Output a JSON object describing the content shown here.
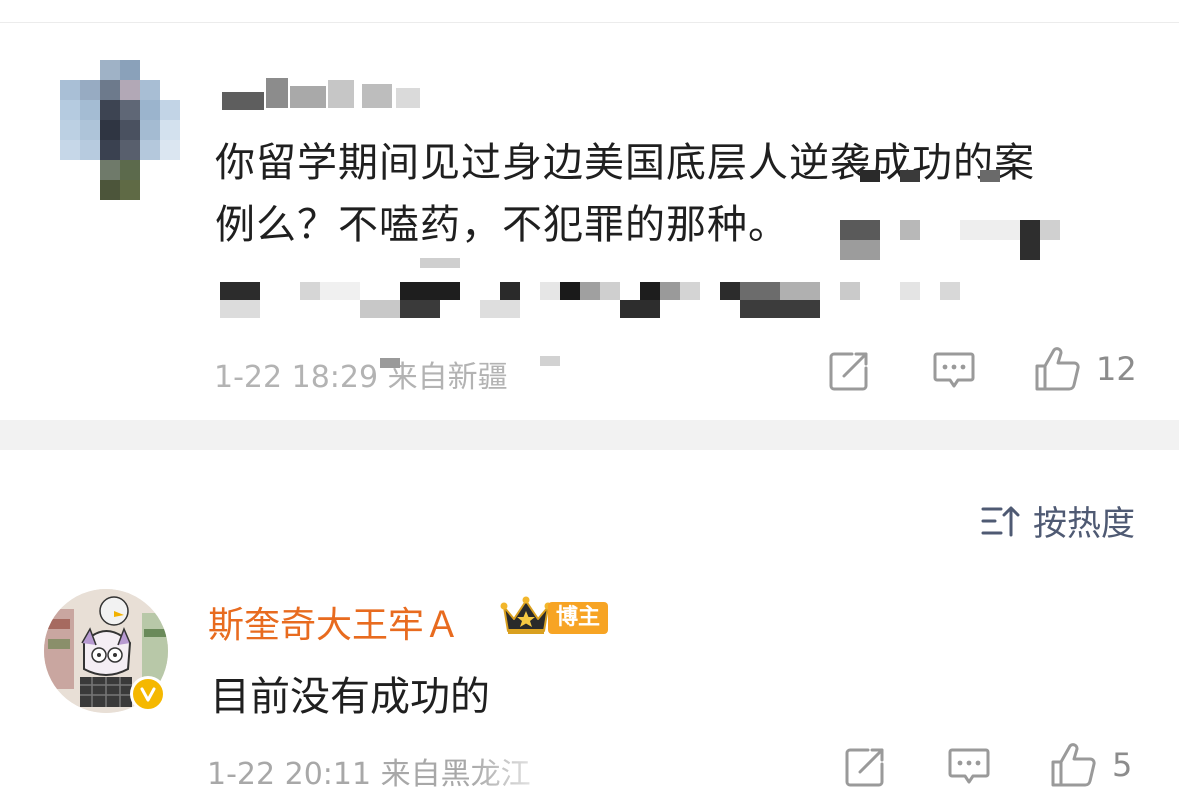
{
  "post": {
    "line1": "你留学期间见过身边美国底层人逆袭成功的案",
    "line2": "例么？不嗑药，不犯罪的那种。",
    "meta": "1-22 18:29 来自新疆",
    "likes": "12"
  },
  "sort": {
    "label": "按热度"
  },
  "comment": {
    "author": "斯奎奇大王牢Ａ",
    "badge": "博主",
    "text": "目前没有成功的",
    "meta": "1-22 20:11 来自黑龙江",
    "likes": "5"
  },
  "colors": {
    "author_orange": "#e86b1f",
    "badge_orange": "#f7a424",
    "icon_gray": "#9a9a9a",
    "sort_blue": "#4f5a73",
    "verified_gold": "#f5b800"
  },
  "icons": [
    "share-icon",
    "comment-icon",
    "like-icon",
    "sort-icon",
    "crown-icon",
    "verified-icon"
  ]
}
